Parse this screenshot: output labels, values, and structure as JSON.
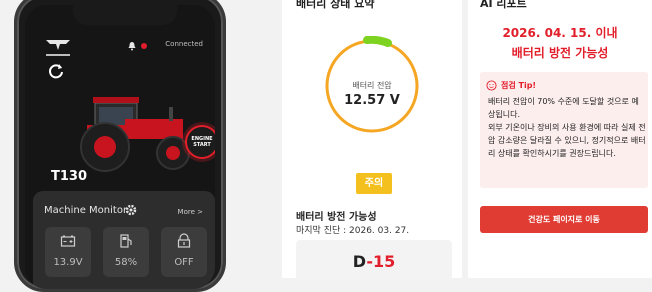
{
  "phone": {
    "status": "Connected",
    "model": "T130",
    "engine_line1": "ENGINE",
    "engine_line2": "START",
    "monitor_title": "Machine Monitor",
    "more_label": "More >",
    "tiles": [
      {
        "icon": "battery-icon",
        "value": "13.9V"
      },
      {
        "icon": "fuel-icon",
        "value": "58%"
      },
      {
        "icon": "lock-icon",
        "value": "OFF"
      }
    ]
  },
  "battery_summary": {
    "title": "배터리 상태 요약",
    "gauge_label": "배터리 전압",
    "gauge_value": "12.57 V",
    "status_badge": "주의",
    "discharge_title": "배터리 방전 가능성",
    "last_diagnosis": "마지막 진단 : 2026. 03. 27.",
    "dday_prefix": "D",
    "dday_dash": "-",
    "dday_num": "15",
    "colors": {
      "accent": "#e21e2a",
      "gauge": "#f5a623",
      "badge": "#f4c01e",
      "gauge_cap": "#7ed321"
    }
  },
  "ai_report": {
    "title": "AI 리포트",
    "date_line": "2026. 04. 15. 이내",
    "subtitle_line": "배터리 방전 가능성",
    "tip_title": "점검 Tip!",
    "tip_body": "배터리 전압이 70% 수준에 도달할 것으로 예상됩니다.\n외부 기온이나 장비의 사용 환경에 따라 실제 전압 감소량은 달라질 수 있으니, 정기적으로 배터리 상태를 확인하시기를 권장드립니다.",
    "cta_label": "건강도 페이지로 이동"
  }
}
